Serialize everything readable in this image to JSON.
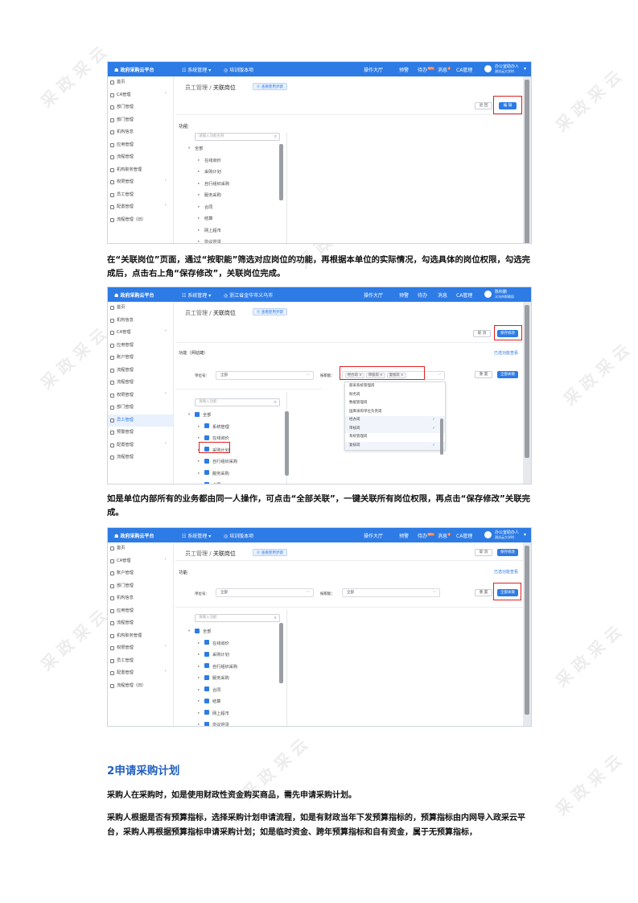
{
  "watermark": "采 政 采 云",
  "top_nav": {
    "logo": "政府采购云平台",
    "menu": "系统管理",
    "workbench_label": "操作大厅",
    "warning": "预警",
    "todo": "待办",
    "todo_badge": "99+",
    "message": "消息",
    "message_badge": "4",
    "ca": "CA管理",
    "user_name": "办公室助办人",
    "user_org": "测试云大学时"
  },
  "screenshot1": {
    "location": "培训版本项",
    "sidebar": [
      {
        "label": "首页"
      },
      {
        "label": "CA管理",
        "arrow": "˅"
      },
      {
        "label": "部门管理"
      },
      {
        "label": "部门管理"
      },
      {
        "label": "机构信息"
      },
      {
        "label": "应用管理"
      },
      {
        "label": "流程管理"
      },
      {
        "label": "机构职务管理"
      },
      {
        "label": "权限管理",
        "arrow": "˅"
      },
      {
        "label": "员工管理"
      },
      {
        "label": "配置管理",
        "arrow": "˅"
      },
      {
        "label": "流程管理（旧）"
      }
    ],
    "crumb_prefix": "员工管理 /",
    "crumb_current": "关联岗位",
    "tag": "⓪ 查看使用步骤",
    "cancel": "退 回",
    "edit": "编 辑",
    "section": "功能",
    "search_placeholder": "请输入功能名称",
    "tree": [
      "全部",
      "在线询价",
      "采购计划",
      "自行组织采购",
      "服务采购",
      "合同",
      "结算",
      "网上超市",
      "协议供货"
    ]
  },
  "para1": "在“关联岗位”页面，通过“按职能”筛选对应岗位的功能，再根据本单位的实际情况，勾选具体的岗位权限，勾选完成后，点击右上角“保存修改”，关联岗位完成。",
  "screenshot2": {
    "location": "浙江省金华市义乌市",
    "user_name": "陈科鹏",
    "user_org": "义乌市财政局",
    "sidebar": [
      {
        "label": "首页"
      },
      {
        "label": "机构信息"
      },
      {
        "label": "CA管理",
        "arrow": "˄"
      },
      {
        "label": "应用管理"
      },
      {
        "label": "账户管理"
      },
      {
        "label": "流程管理"
      },
      {
        "label": "流程管理"
      },
      {
        "label": "权限管理",
        "arrow": "˅"
      },
      {
        "label": "部门管理"
      },
      {
        "label": "员工管理",
        "active": true
      },
      {
        "label": "预警管理"
      },
      {
        "label": "配置管理",
        "arrow": "˅"
      },
      {
        "label": "流程管理"
      }
    ],
    "crumb_prefix": "员工管理 /",
    "crumb_current": "关联岗位",
    "tag": "⓪ 查看使用步骤",
    "cancel": "取 消",
    "save": "保存修改",
    "section": "功能（师姑婕）",
    "link": "已选功能查看",
    "unit_label": "单位号：",
    "unit_value": "全部",
    "duty_label": "按职能：",
    "chips": [
      "经办岗 ×",
      "审核岗 ×",
      "复核岗 ×"
    ],
    "reset": "重 置",
    "link_all": "全部关联",
    "search_placeholder": "请输入功能",
    "tree": [
      "全部",
      "系统管理",
      "在线询价",
      "采购计划",
      "自行组织采购",
      "服务采购",
      "合同",
      "结算"
    ],
    "dropdown": [
      {
        "label": "部采系统管理岗",
        "check": ""
      },
      {
        "label": "财务岗",
        "check": ""
      },
      {
        "label": "数据管理岗",
        "check": ""
      },
      {
        "label": "国库采购单位负责岗",
        "check": ""
      },
      {
        "label": "经办岗",
        "check": "✓"
      },
      {
        "label": "审核岗",
        "check": "✓"
      },
      {
        "label": "系统管理岗",
        "check": ""
      },
      {
        "label": "复核岗",
        "check": "✓"
      }
    ]
  },
  "para2": "如是单位内部所有的业务都由同一人操作，可点击“全部关联”，一键关联所有岗位权限，再点击“保存修改”关联完成。",
  "screenshot3": {
    "location": "培训版本项",
    "sidebar": [
      {
        "label": "首页"
      },
      {
        "label": "CA管理",
        "arrow": "˅"
      },
      {
        "label": "账户管理"
      },
      {
        "label": "部门管理"
      },
      {
        "label": "机构信息"
      },
      {
        "label": "应用管理"
      },
      {
        "label": "流程管理"
      },
      {
        "label": "机构职务管理"
      },
      {
        "label": "权限管理",
        "arrow": "˅"
      },
      {
        "label": "员工管理"
      },
      {
        "label": "配置管理",
        "arrow": "˅"
      },
      {
        "label": "流程管理（旧）"
      }
    ],
    "crumb_prefix": "员工管理 /",
    "crumb_current": "关联岗位",
    "tag": "⓪ 查看使用步骤",
    "cancel": "取 消",
    "save": "保存修改",
    "section": "功能",
    "link": "已选功能查看",
    "unit_label": "单位号：",
    "unit_value": "全部",
    "duty_label": "按职能：",
    "duty_value": "全部",
    "reset": "重 置",
    "link_all": "全部关联",
    "search_placeholder": "请输入功能",
    "tree": [
      "全部",
      "在线询价",
      "采购计划",
      "自行组织采购",
      "服务采购",
      "合同",
      "结算",
      "网上超市",
      "协议供货"
    ]
  },
  "heading": "2申请采购计划",
  "para3": "采购人在采购时，如是使用财政性资金购买商品，需先申请采购计划。",
  "para4": "采购人根据是否有预算指标，选择采购计划申请流程，如是有财政当年下发预算指标的，预算指标由内网导入政采云平台，采购人再根据预算指标申请采购计划；如是临时资金、跨年预算指标和自有资金，属于无预算指标，"
}
